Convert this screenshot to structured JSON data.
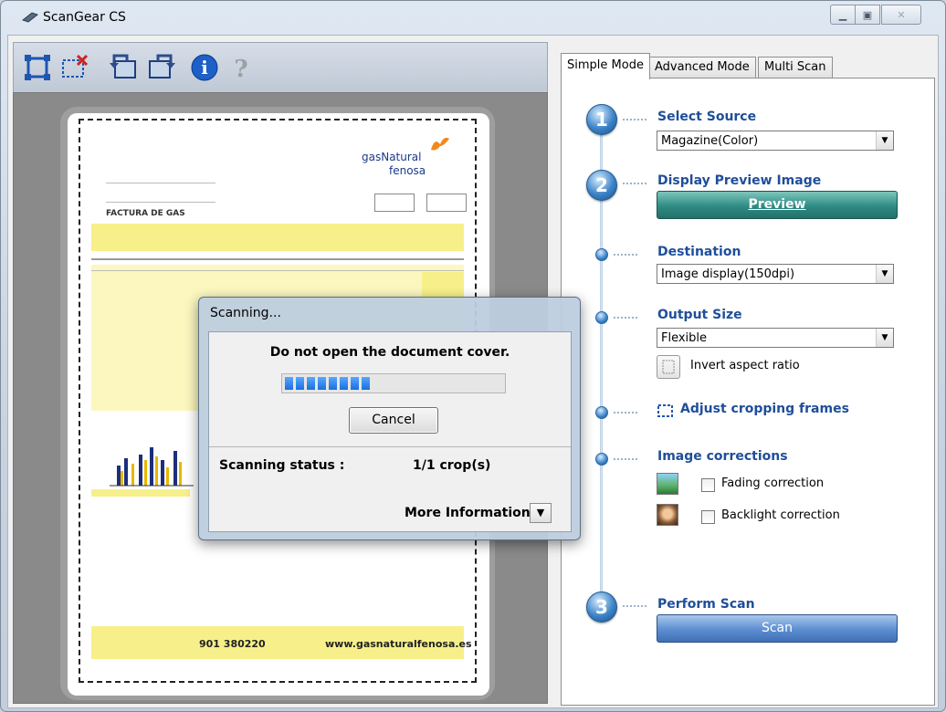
{
  "window": {
    "title": "ScanGear CS"
  },
  "toolbar": {
    "buttons": [
      "auto-crop",
      "remove-crop",
      "rotate-left",
      "rotate-right",
      "info",
      "help"
    ]
  },
  "tabs": [
    {
      "label": "Simple Mode",
      "active": true
    },
    {
      "label": "Advanced Mode",
      "active": false
    },
    {
      "label": "Multi Scan",
      "active": false
    }
  ],
  "steps": {
    "select_source": {
      "number": "1",
      "label": "Select Source",
      "value": "Magazine(Color)"
    },
    "display_preview": {
      "number": "2",
      "label": "Display Preview Image",
      "button": "Preview"
    },
    "destination": {
      "label": "Destination",
      "value": "Image display(150dpi)"
    },
    "output_size": {
      "label": "Output Size",
      "value": "Flexible",
      "invert_label": "Invert aspect ratio"
    },
    "adjust_crop": {
      "label": "Adjust cropping frames"
    },
    "image_corrections": {
      "label": "Image corrections",
      "fading": "Fading correction",
      "backlight": "Backlight correction"
    },
    "perform_scan": {
      "number": "3",
      "label": "Perform Scan",
      "button": "Scan"
    }
  },
  "document": {
    "brand_line1": "gasNatural",
    "brand_line2": "fenosa",
    "heading": "FACTURA DE GAS",
    "phone": "901 380220",
    "website": "www.gasnaturalfenosa.es"
  },
  "dialog": {
    "title": "Scanning...",
    "message": "Do not open the document cover.",
    "progress_segments": 8,
    "cancel": "Cancel",
    "status_label": "Scanning status :",
    "status_value": "1/1 crop(s)",
    "more_info": "More Information"
  },
  "colors": {
    "accent_teal": "#2e8c84",
    "accent_blue": "#4f7fc4",
    "progress": "#1a6fdc"
  }
}
